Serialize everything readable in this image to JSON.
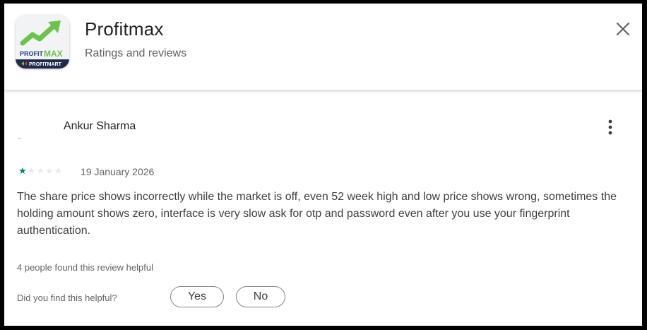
{
  "app": {
    "name": "Profitmax",
    "subtitle": "Ratings and reviews",
    "icon": {
      "name": "profitmax-logo-icon",
      "text_line1": "PROFIT",
      "text_line2": "MAX",
      "brand": "PROFITMART",
      "colors": {
        "bg": "#f1f3f4",
        "arrow": "#6cc24a",
        "text_blue": "#1f3c88",
        "text_green": "#6cc24a",
        "band": "#1f2b4d"
      }
    }
  },
  "close": {
    "icon": "close-icon"
  },
  "review": {
    "author": "Ankur Sharma",
    "rating": 1,
    "max_rating": 5,
    "date": "19 January 2026",
    "text": "The share price shows incorrectly while the market is off, even 52 week high and low price shows wrong, sometimes the holding amount shows zero, interface is very slow ask for otp and password even after you use your fingerprint authentication.",
    "helpful_count_text": "4 people found this review helpful",
    "helpful_question": "Did you find this helpful?",
    "yes_label": "Yes",
    "no_label": "No",
    "more_icon": "more-vert-icon",
    "colors": {
      "star_on": "#01875f",
      "star_off": "#e8eaed"
    }
  }
}
